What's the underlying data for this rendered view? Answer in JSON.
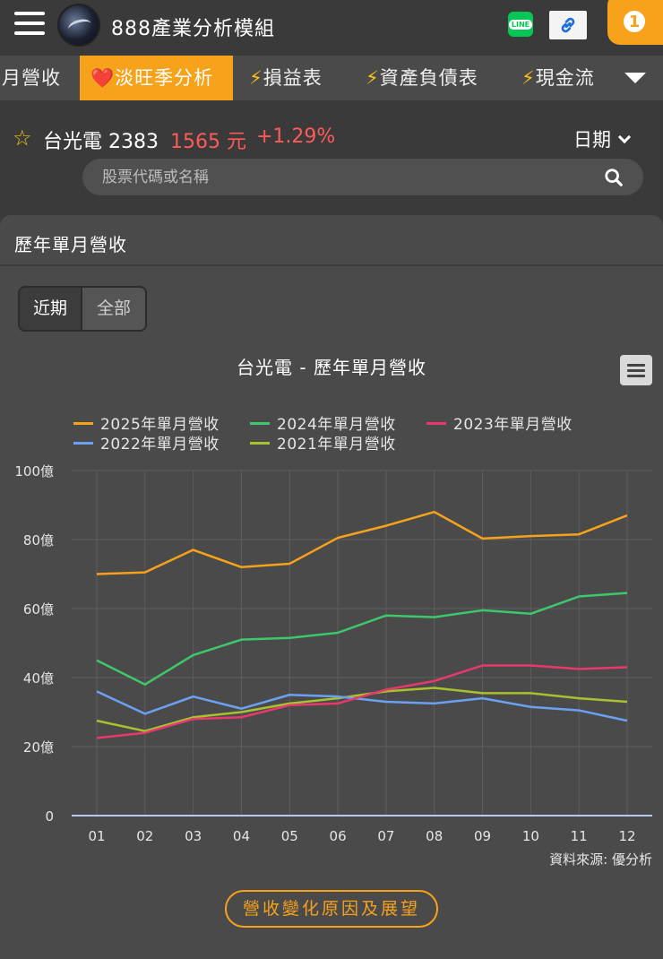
{
  "header": {
    "app_title": "888產業分析模組",
    "line_label": "LINE",
    "notification_count": "1"
  },
  "tabs": [
    {
      "label": "月營收",
      "prefix": "",
      "active": false
    },
    {
      "label": "淡旺季分析",
      "prefix": "❤️",
      "active": true
    },
    {
      "label": "損益表",
      "prefix": "⚡",
      "active": false
    },
    {
      "label": "資產負債表",
      "prefix": "⚡",
      "active": false
    },
    {
      "label": "現金流",
      "prefix": "⚡",
      "active": false
    }
  ],
  "stock": {
    "name": "台光電 2383",
    "price": "1565 元",
    "change": "+1.29%",
    "date_label": "日期"
  },
  "search": {
    "placeholder": "股票代碼或名稱"
  },
  "card": {
    "title": "歷年單月營收",
    "segments": [
      {
        "label": "近期",
        "selected": true
      },
      {
        "label": "全部",
        "selected": false
      }
    ]
  },
  "chart_data": {
    "type": "line",
    "title": "台光電 - 歷年單月營收",
    "categories": [
      "01",
      "02",
      "03",
      "04",
      "05",
      "06",
      "07",
      "08",
      "09",
      "10",
      "11",
      "12"
    ],
    "yticks": [
      "0",
      "20億",
      "40億",
      "60億",
      "80億",
      "100億"
    ],
    "ylim": [
      0,
      100
    ],
    "grid": true,
    "legend_position": "top",
    "series": [
      {
        "name": "2025年單月營收",
        "color": "#f7a21b",
        "values": [
          70,
          70.5,
          77,
          72,
          73,
          80.5,
          84,
          88,
          80.3,
          81,
          81.5,
          87
        ]
      },
      {
        "name": "2024年單月營收",
        "color": "#3ec76b",
        "values": [
          45,
          38,
          46.5,
          51,
          51.5,
          53,
          58,
          57.5,
          59.5,
          58.5,
          63.5,
          64.5
        ]
      },
      {
        "name": "2023年單月營收",
        "color": "#e8386d",
        "values": [
          22.5,
          24,
          28,
          28.5,
          32,
          32.5,
          36.5,
          39,
          43.5,
          43.5,
          42.5,
          43
        ]
      },
      {
        "name": "2022年單月營收",
        "color": "#6ba1f2",
        "values": [
          36,
          29.5,
          34.5,
          31,
          35,
          34.5,
          33,
          32.5,
          34,
          31.5,
          30.5,
          27.5
        ]
      },
      {
        "name": "2021年單月營收",
        "color": "#a6c22e",
        "values": [
          27.5,
          24.5,
          28.5,
          30,
          32.5,
          34,
          36,
          37,
          35.5,
          35.5,
          34,
          33
        ]
      }
    ],
    "source": "資料來源: 優分析"
  },
  "cta_label": "營收變化原因及展望"
}
